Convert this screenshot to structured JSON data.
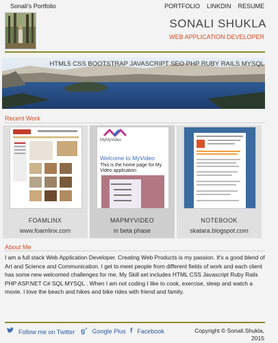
{
  "header": {
    "brand": "Sonali's Portfolio",
    "nav": [
      "PORTFOLIO",
      "LINKDIN",
      "RESUME"
    ],
    "name": "SONALI SHUKLA",
    "role": "WEB APPLICATION DEVELOPER",
    "skills": "HTML5 CSS BOOTSTRAP JAVASCRIPT SEO PHP RUBY RAILS MYSQL"
  },
  "recent_work": {
    "title": "Recent Work",
    "items": [
      {
        "title": "FOAMLINX",
        "subtitle": "www.foamlinx.com"
      },
      {
        "title": "MAPMYVIDEO",
        "subtitle": "in beta phase"
      },
      {
        "title": "NOTEBOOK",
        "subtitle": "skatara.blogspot.com"
      }
    ],
    "mapmyvideo_thumb": {
      "logo": "MyMyVideo",
      "welcome": "Welcome to MyVideo",
      "text": "This is the home page for My Video application"
    }
  },
  "about": {
    "title": "About Me",
    "text": "I am a full stack Web Application Developer. Creating Web Products is my passion. It's a good blend of Art and Science and Communication. I get to meet people from different fields of work and each client has some new welcomed challenges for me. My Skill set includes HTML CSS Javascript Ruby Rails PHP ASP.NET C# SQL MYSQL . When I am not coding I like to cook, exercise, sleep and watch a movie. I love the beach and hikes and bike rides with friend and family."
  },
  "footer": {
    "twitter": "Follow me on Twitter",
    "gplus": "Google Plus",
    "facebook": "Facebook",
    "copyright_line1": "Copyright © Sonali.Shukla,",
    "copyright_line2": "2015",
    "icons": {
      "twitter": "twitter-icon",
      "gplus": "google-plus-icon",
      "facebook": "facebook-icon"
    }
  },
  "colors": {
    "accent": "#d04a1f",
    "rule": "#8a8a2a",
    "link": "#2a5aa0"
  }
}
